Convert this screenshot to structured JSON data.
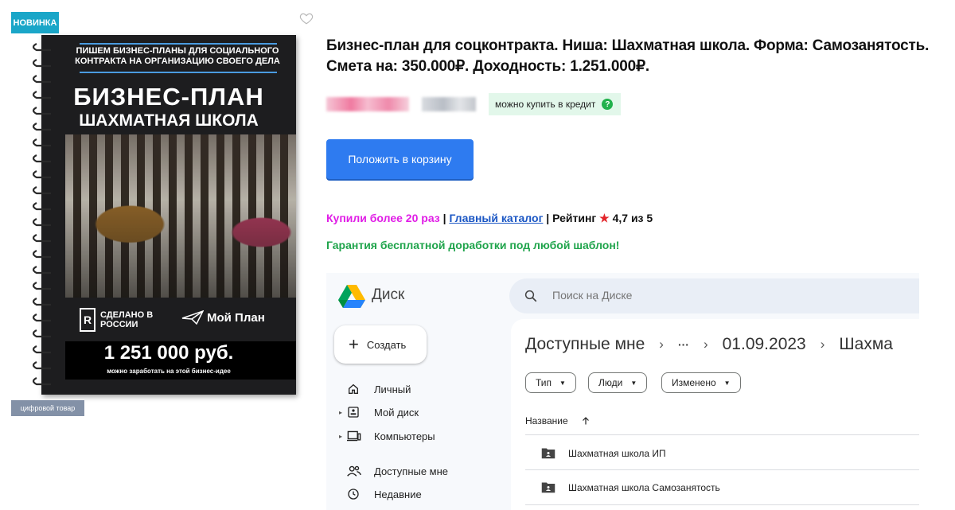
{
  "product": {
    "badge_new": "НОВИНКА",
    "badge_digital": "цифровой товар",
    "title": "Бизнес-план для соцконтракта. Ниша: Шахматная школа. Форма: Самозанятость. Смета на: 350.000₽. Доходность: 1.251.000₽.",
    "credit_label": "можно купить в кредит",
    "credit_icon": "question-icon",
    "add_to_cart": "Положить в корзину",
    "stats": {
      "bought": "Купили более 20 раз",
      "separator1": " | ",
      "catalog_link": "Главный каталог",
      "separator2": " | ",
      "rating_label": "Рейтинг",
      "star": "★",
      "rating_value": "4,7 из 5"
    },
    "guarantee": "Гарантия бесплатной доработки под любой шаблон!",
    "colors": {
      "accent_blue": "#2e7bf0",
      "pink": "#e01ce6",
      "green": "#1fa44b",
      "badge": "#1aa6c8"
    }
  },
  "cover": {
    "subtitle_top": "ПИШЕМ БИЗНЕС-ПЛАНЫ ДЛЯ СОЦИАЛЬНОГО КОНТРАКТА НА ОРГАНИЗАЦИЮ СВОЕГО ДЕЛА",
    "title": "БИЗНЕС-ПЛАН",
    "subtitle": "ШАХМАТНАЯ ШКОЛА",
    "logo_made_letter": "R",
    "logo_made_text": "СДЕЛАНО В РОССИИ",
    "logo_plan_text": "Мой План",
    "price": "1 251 000 руб.",
    "price_note": "можно заработать на этой бизнес-идее"
  },
  "drive": {
    "app_name": "Диск",
    "search_placeholder": "Поиск на Диске",
    "create_label": "Создать",
    "nav": [
      {
        "label": "Личный",
        "icon": "home-icon"
      },
      {
        "label": "Мой диск",
        "icon": "drive-icon"
      },
      {
        "label": "Компьютеры",
        "icon": "computer-icon"
      },
      {
        "label": "Доступные мне",
        "icon": "people-icon"
      },
      {
        "label": "Недавние",
        "icon": "clock-icon"
      }
    ],
    "breadcrumb": {
      "root": "Доступные мне",
      "more": "···",
      "folder": "01.09.2023",
      "current": "Шахма"
    },
    "filters": [
      "Тип",
      "Люди",
      "Изменено"
    ],
    "column_name": "Название",
    "sort_icon": "arrow-up-icon",
    "files": [
      {
        "name": "Шахматная школа ИП",
        "icon": "shared-folder-icon"
      },
      {
        "name": "Шахматная школа Самозанятость",
        "icon": "shared-folder-icon"
      }
    ]
  }
}
